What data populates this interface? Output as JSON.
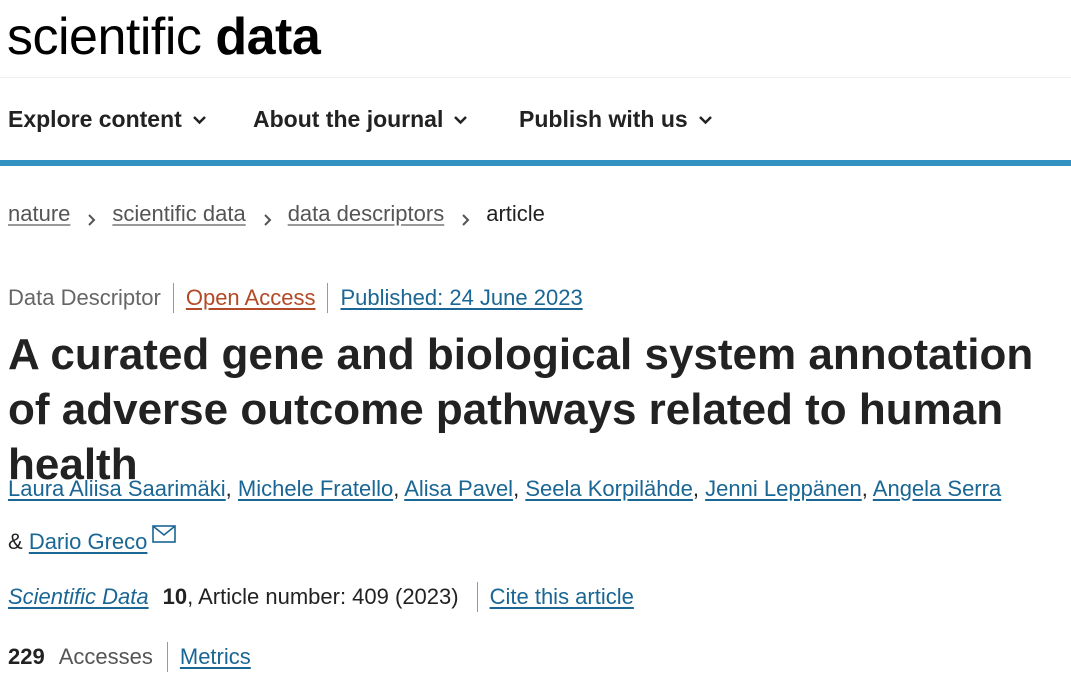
{
  "masthead": {
    "logo_light": "scientific",
    "logo_bold": "data"
  },
  "nav": {
    "items": [
      {
        "label": "Explore content"
      },
      {
        "label": "About the journal"
      },
      {
        "label": "Publish with us"
      }
    ]
  },
  "breadcrumb": {
    "items": [
      "nature",
      "scientific data",
      "data descriptors"
    ],
    "current": "article"
  },
  "article": {
    "type": "Data Descriptor",
    "access": "Open Access",
    "published": "Published: 24 June 2023",
    "title": "A curated gene and biological system annotation of adverse outcome pathways related to human health",
    "authors": [
      "Laura Aliisa Saarimäki",
      "Michele Fratello",
      "Alisa Pavel",
      "Seela Korpilähde",
      "Jenni Leppänen",
      "Angela Serra",
      "Dario Greco"
    ],
    "author_separator": ",",
    "author_last_joiner": "&",
    "journal": "Scientific Data",
    "volume": "10",
    "article_number": ", Article number: 409 (2023)",
    "cite_label": "Cite this article",
    "accesses_count": "229",
    "accesses_label": "Accesses",
    "metrics_label": "Metrics"
  },
  "icons": {
    "nav_chevron": "chevron-down-icon",
    "breadcrumb_separator": "chevron-right-icon",
    "corresponding_author": "envelope-icon"
  },
  "colors": {
    "accent_bar": "#3492c2",
    "link": "#1a6694",
    "open_access": "#b24a27"
  }
}
